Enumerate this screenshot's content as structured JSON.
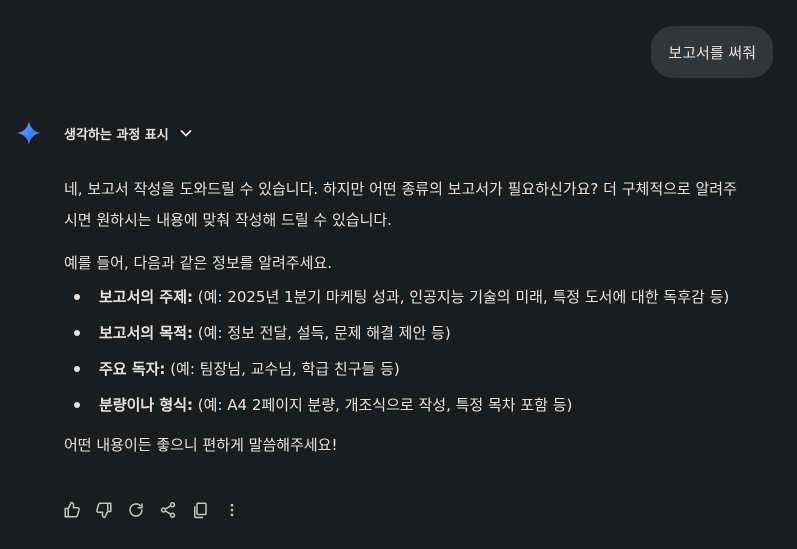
{
  "user_message": "보고서를 써줘",
  "thinking": {
    "label": "생각하는 과정 표시"
  },
  "response": {
    "intro_line1": "네, 보고서 작성을 도와드릴 수 있습니다. 하지만 어떤 종류의 보고서가 필요하신가요? 더 구체적으로 알려주",
    "intro_line2": "시면 원하시는 내용에 맞춰 작성해 드릴 수 있습니다.",
    "list_intro": "예를 들어, 다음과 같은 정보를 알려주세요.",
    "items": [
      {
        "label": "보고서의 주제:",
        "text": " (예: 2025년 1분기 마케팅 성과, 인공지능 기술의 미래, 특정 도서에 대한 독후감 등)"
      },
      {
        "label": "보고서의 목적:",
        "text": " (예: 정보 전달, 설득, 문제 해결 제안 등)"
      },
      {
        "label": "주요 독자:",
        "text": " (예: 팀장님, 교수님, 학급 친구들 등)"
      },
      {
        "label": "분량이나 형식:",
        "text": " (예: A4 2페이지 분량, 개조식으로 작성, 특정 목차 포함 등)"
      }
    ],
    "closing": "어떤 내용이든 좋으니 편하게 말씀해주세요!"
  },
  "actions": [
    {
      "icon": "thumbs-up-icon"
    },
    {
      "icon": "thumbs-down-icon"
    },
    {
      "icon": "regenerate-icon"
    },
    {
      "icon": "share-icon"
    },
    {
      "icon": "copy-icon"
    },
    {
      "icon": "more-vert-icon"
    }
  ],
  "colors": {
    "background": "#1b1c1d",
    "user_bubble": "#333537",
    "text": "#e3e3e3",
    "icon": "#c4c7c5",
    "sparkle_blue": "#4285f4",
    "sparkle_light": "#8ab4f8"
  }
}
